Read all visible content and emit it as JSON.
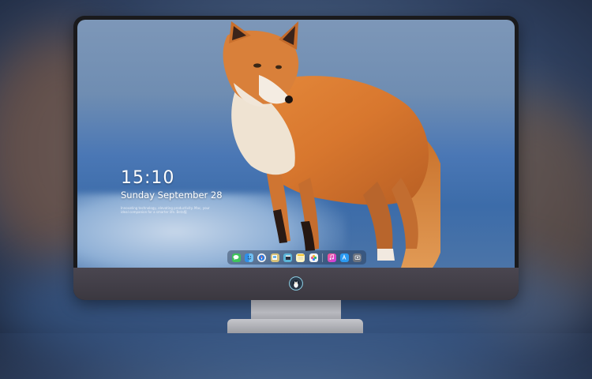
{
  "lock_screen": {
    "time": "15:10",
    "date": "Sunday September 28",
    "tagline": "Innovating technology, elevating productivity. Mac, your ideal companion for a smarter life. Beta版"
  },
  "dock": {
    "apps": [
      {
        "name": "messages-icon",
        "color": "#3fc35b",
        "glyph": "💬"
      },
      {
        "name": "finder-icon",
        "color": "#2f8fe8",
        "glyph": "☺"
      },
      {
        "name": "safari-icon",
        "color": "#e8e8e8",
        "glyph": "◎"
      },
      {
        "name": "preview-icon",
        "color": "#d9c27a",
        "glyph": "▤"
      },
      {
        "name": "clapper-icon",
        "color": "#5bb5d8",
        "glyph": "▶"
      },
      {
        "name": "notes-icon",
        "color": "#f3d04a",
        "glyph": "≡"
      },
      {
        "name": "photos-icon",
        "color": "#e7e7e7",
        "glyph": "❀"
      },
      {
        "name": "music-icon",
        "color": "#f2578f",
        "glyph": "♫"
      },
      {
        "name": "app-store-icon",
        "color": "#2a9af2",
        "glyph": "A"
      },
      {
        "name": "screenshot-icon",
        "color": "#6d7480",
        "glyph": "▣"
      }
    ]
  },
  "brand": {
    "logo_icon": "penguin-logo-icon"
  }
}
